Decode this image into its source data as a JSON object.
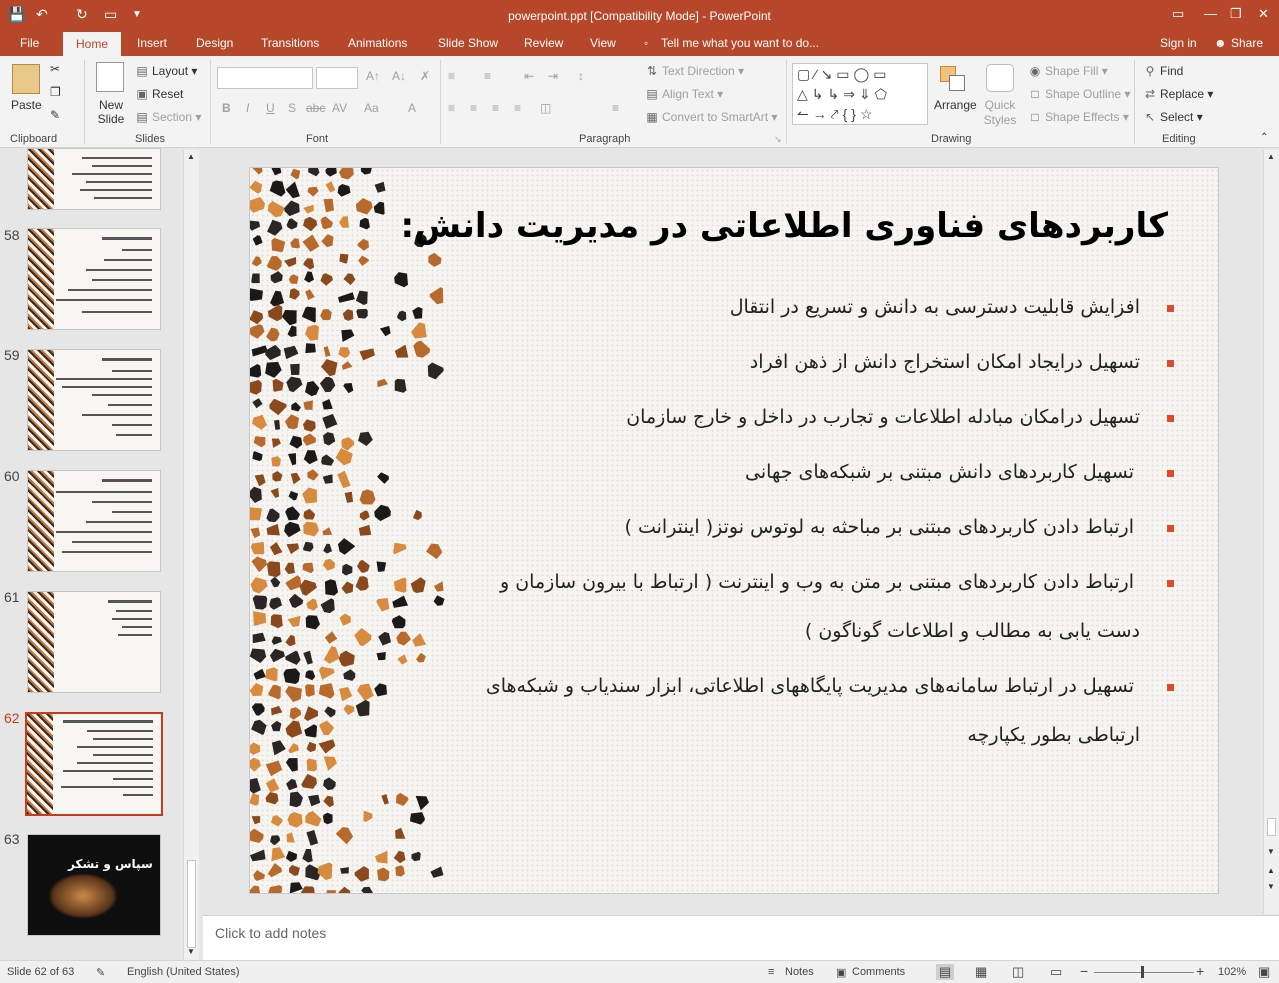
{
  "window": {
    "title": "powerpoint.ppt [Compatibility Mode] - PowerPoint"
  },
  "tabs": [
    "File",
    "Home",
    "Insert",
    "Design",
    "Transitions",
    "Animations",
    "Slide Show",
    "Review",
    "View"
  ],
  "tell_me": "Tell me what you want to do...",
  "account": {
    "sign_in": "Sign in",
    "share": "Share"
  },
  "ribbon": {
    "clipboard": {
      "label": "Clipboard",
      "paste": "Paste"
    },
    "slides": {
      "label": "Slides",
      "new_slide": "New Slide",
      "layout": "Layout",
      "reset": "Reset",
      "section": "Section"
    },
    "font": {
      "label": "Font"
    },
    "paragraph": {
      "label": "Paragraph",
      "text_direction": "Text Direction",
      "align_text": "Align Text",
      "convert_smartart": "Convert to SmartArt"
    },
    "drawing": {
      "label": "Drawing",
      "arrange": "Arrange",
      "quick_styles": "Quick Styles",
      "shape_fill": "Shape Fill",
      "shape_outline": "Shape Outline",
      "shape_effects": "Shape Effects"
    },
    "editing": {
      "label": "Editing",
      "find": "Find",
      "replace": "Replace",
      "select": "Select"
    }
  },
  "thumbnails": [
    {
      "num": "58"
    },
    {
      "num": "59"
    },
    {
      "num": "60"
    },
    {
      "num": "61"
    },
    {
      "num": "62"
    },
    {
      "num": "63",
      "title": "سپاس و تشکر"
    }
  ],
  "slide": {
    "title": "کاربردهای فناوری اطلاعاتی در مدیریت دانش:",
    "bullets": [
      "افزایش قابلیت دسترسی به دانش و تسریع در انتقال",
      "تسهیل درایجاد امکان استخراج دانش از ذهن افراد",
      "تسهیل درامکان مبادله اطلاعات و تجارب در داخل و خارج سازمان",
      "تسهیل کاربردهای دانش مبتنی بر شبکه‌های جهانی",
      "ارتباط دادن کاربردهای مبتنی بر مباحثه به لوتوس نوتز( اینترانت )",
      "ارتباط دادن کاربردهای مبتنی بر متن به وب و اینترنت ( ارتباط با بیرون سازمان و",
      "دست یابی به مطالب و اطلاعات گوناگون )",
      "تسهیل در ارتباط سامانه‌های مدیریت پایگاههای اطلاعاتی، ابزار سندیاب و شبکه‌های",
      "ارتباطی بطور یکپارچه"
    ]
  },
  "notes_placeholder": "Click to add notes",
  "status": {
    "slide": "Slide 62 of 63",
    "language": "English (United States)",
    "notes": "Notes",
    "comments": "Comments",
    "zoom": "102%"
  },
  "colors": {
    "accent": "#b7472a",
    "bullet": "#e04a2a"
  }
}
